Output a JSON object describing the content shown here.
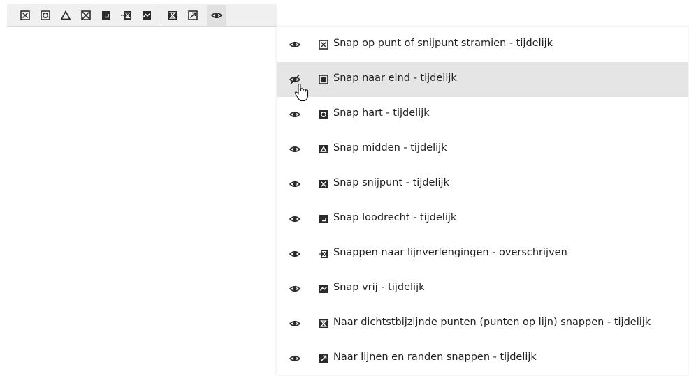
{
  "toolbar": {
    "buttons": [
      {
        "name": "snap-grid-button",
        "icon": "snap-grid-intersection-icon"
      },
      {
        "name": "snap-center-button",
        "icon": "snap-center-icon"
      },
      {
        "name": "snap-midpoint-button",
        "icon": "snap-midpoint-icon"
      },
      {
        "name": "snap-intersection-button",
        "icon": "snap-intersection-icon"
      },
      {
        "name": "snap-perpendicular-button",
        "icon": "snap-perpendicular-icon"
      },
      {
        "name": "snap-extension-button",
        "icon": "snap-extension-icon"
      },
      {
        "name": "snap-free-button",
        "icon": "snap-free-icon"
      },
      {
        "name": "snap-nearest-button",
        "icon": "snap-nearest-icon"
      },
      {
        "name": "snap-lines-edges-button",
        "icon": "snap-lines-edges-icon"
      },
      {
        "name": "visibility-menu-button",
        "icon": "eye-icon"
      }
    ]
  },
  "menu": {
    "items": [
      {
        "label": "Snap op punt of snijpunt stramien - tijdelijk",
        "icon": "snap-grid-intersection-icon",
        "visible": true
      },
      {
        "label": "Snap naar eind - tijdelijk",
        "icon": "snap-endpoint-icon",
        "visible": false
      },
      {
        "label": "Snap hart - tijdelijk",
        "icon": "snap-center-icon",
        "visible": true
      },
      {
        "label": "Snap midden - tijdelijk",
        "icon": "snap-midpoint-icon",
        "visible": true
      },
      {
        "label": "Snap snijpunt - tijdelijk",
        "icon": "snap-intersection-icon",
        "visible": true
      },
      {
        "label": "Snap loodrecht - tijdelijk",
        "icon": "snap-perpendicular-icon",
        "visible": true
      },
      {
        "label": "Snappen naar lijnverlengingen - overschrijven",
        "icon": "snap-extension-icon",
        "visible": true
      },
      {
        "label": "Snap vrij - tijdelijk",
        "icon": "snap-free-icon",
        "visible": true
      },
      {
        "label": "Naar dichtstbijzijnde punten (punten op lijn) snappen - tijdelijk",
        "icon": "snap-nearest-icon",
        "visible": true
      },
      {
        "label": "Naar lijnen en randen snappen - tijdelijk",
        "icon": "snap-lines-edges-icon",
        "visible": true
      }
    ],
    "hovered_index": 1
  },
  "colors": {
    "toolbar_bg": "#f0f0f0",
    "hover_bg": "#e5e5e5",
    "icon_dark": "#2b2b2b",
    "text": "#222222"
  }
}
